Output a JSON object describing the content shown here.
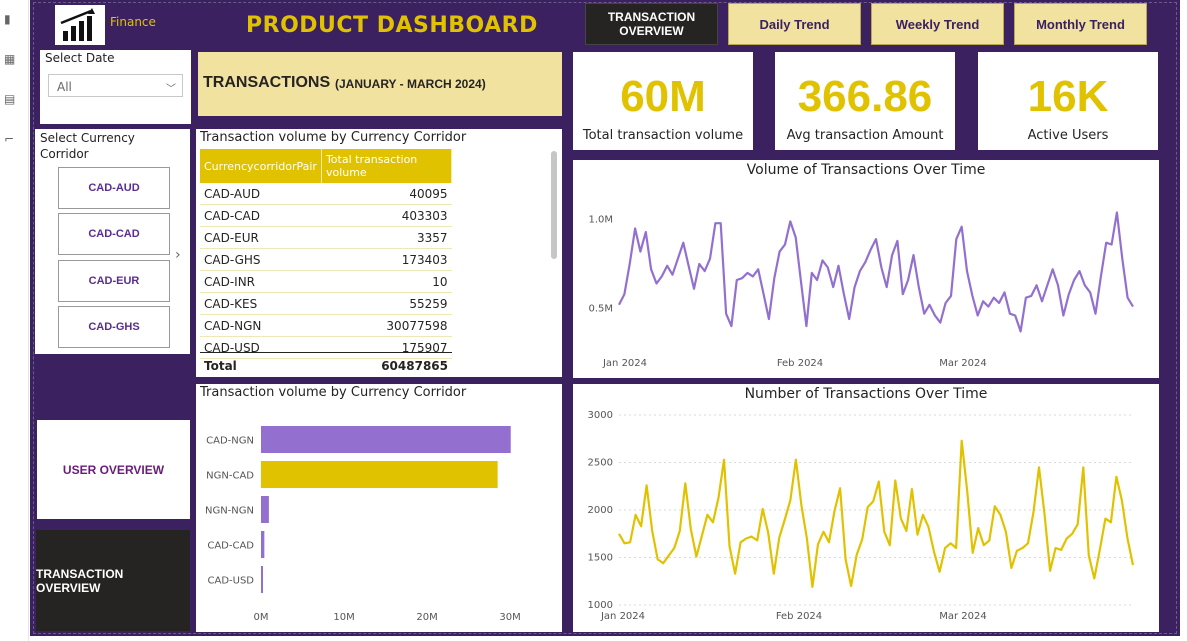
{
  "header": {
    "brand": "Finance",
    "title": "PRODUCT DASHBOARD"
  },
  "nav": {
    "transaction_overview": "TRANSACTION\nOVERVIEW",
    "daily_trend": "Daily Trend",
    "weekly_trend": "Weekly Trend",
    "monthly_trend": "Monthly Trend"
  },
  "date_filter": {
    "label": "Select Date",
    "value": "All"
  },
  "transactions_banner": {
    "title": "TRANSACTIONS",
    "range": "(JANUARY - MARCH 2024)"
  },
  "kpis": [
    {
      "value": "60M",
      "label": "Total transaction volume"
    },
    {
      "value": "366.86",
      "label": "Avg transaction Amount"
    },
    {
      "value": "16K",
      "label": "Active Users"
    }
  ],
  "currency_slicer": {
    "label": "Select Currency Corridor",
    "items": [
      "CAD-AUD",
      "CAD-CAD",
      "CAD-EUR",
      "CAD-GHS"
    ]
  },
  "volume_table": {
    "title": "Transaction volume by Currency Corridor",
    "columns": [
      "CurrencycorridorPair",
      "Total transaction volume"
    ],
    "rows": [
      [
        "CAD-AUD",
        "40095"
      ],
      [
        "CAD-CAD",
        "403303"
      ],
      [
        "CAD-EUR",
        "3357"
      ],
      [
        "CAD-GHS",
        "173403"
      ],
      [
        "CAD-INR",
        "10"
      ],
      [
        "CAD-KES",
        "55259"
      ],
      [
        "CAD-NGN",
        "30077598"
      ],
      [
        "CAD-USD",
        "175907"
      ]
    ],
    "total_label": "Total",
    "total_value": "60487865"
  },
  "side_buttons": {
    "user_overview": "USER OVERVIEW",
    "transaction_overview": "TRANSACTION OVERVIEW"
  },
  "colors": {
    "purple": "#9370d0",
    "gold": "#e1c200",
    "canvas": "#3b2160"
  },
  "chart_data": [
    {
      "type": "bar",
      "orientation": "horizontal",
      "title": "Transaction volume by Currency Corridor",
      "categories": [
        "CAD-NGN",
        "NGN-CAD",
        "NGN-NGN",
        "CAD-CAD",
        "CAD-USD"
      ],
      "values": [
        30077598,
        28500000,
        950000,
        403303,
        175907
      ],
      "bar_colors": [
        "#9370d0",
        "#e1c200",
        "#9370d0",
        "#9370d0",
        "#9370d0"
      ],
      "xticks": [
        "0M",
        "10M",
        "20M",
        "30M"
      ],
      "xlim": [
        0,
        33000000
      ]
    },
    {
      "type": "line",
      "title": "Volume of Transactions Over Time",
      "x_labels": [
        "Jan 2024",
        "Feb 2024",
        "Mar 2024"
      ],
      "yticks": [
        "0.5M",
        "1.0M"
      ],
      "ylim": [
        0.35,
        1.15
      ],
      "color": "#9370d0",
      "values": [
        0.52,
        0.58,
        0.75,
        0.95,
        0.82,
        0.93,
        0.72,
        0.64,
        0.68,
        0.74,
        0.69,
        0.78,
        0.87,
        0.74,
        0.61,
        0.75,
        0.71,
        0.78,
        0.98,
        0.98,
        0.47,
        0.4,
        0.66,
        0.67,
        0.7,
        0.68,
        0.72,
        0.58,
        0.44,
        0.67,
        0.82,
        0.86,
        0.99,
        0.9,
        0.65,
        0.4,
        0.7,
        0.66,
        0.77,
        0.73,
        0.62,
        0.74,
        0.58,
        0.44,
        0.62,
        0.71,
        0.76,
        0.83,
        0.89,
        0.73,
        0.62,
        0.8,
        0.88,
        0.58,
        0.66,
        0.8,
        0.62,
        0.47,
        0.52,
        0.46,
        0.42,
        0.53,
        0.57,
        0.89,
        0.96,
        0.71,
        0.57,
        0.46,
        0.54,
        0.51,
        0.56,
        0.53,
        0.59,
        0.47,
        0.46,
        0.37,
        0.56,
        0.57,
        0.63,
        0.54,
        0.63,
        0.72,
        0.63,
        0.46,
        0.58,
        0.66,
        0.71,
        0.63,
        0.59,
        0.47,
        0.68,
        0.87,
        0.86,
        1.04,
        0.78,
        0.56,
        0.51
      ]
    },
    {
      "type": "line",
      "title": "Number of Transactions Over Time",
      "x_labels": [
        "Jan 2024",
        "Feb 2024",
        "Mar 2024"
      ],
      "yticks": [
        "1000",
        "1500",
        "2000",
        "2500",
        "3000"
      ],
      "ylim": [
        1000,
        3000
      ],
      "color": "#e1c200",
      "values": [
        1750,
        1650,
        1660,
        1950,
        1830,
        2260,
        1780,
        1480,
        1440,
        1520,
        1600,
        1780,
        2280,
        1800,
        1510,
        1730,
        1950,
        1870,
        2130,
        2530,
        1620,
        1330,
        1660,
        1700,
        1720,
        1680,
        2010,
        1760,
        1330,
        1710,
        1900,
        2100,
        2530,
        2050,
        1700,
        1190,
        1640,
        1770,
        1660,
        1990,
        2230,
        1480,
        1200,
        1530,
        1690,
        2030,
        2090,
        2300,
        1770,
        1630,
        2310,
        1910,
        1780,
        2220,
        1740,
        1950,
        1820,
        1560,
        1350,
        1600,
        1650,
        1600,
        2730,
        2200,
        1550,
        1810,
        1630,
        1680,
        2040,
        1950,
        1770,
        1390,
        1570,
        1600,
        1650,
        1980,
        2450,
        1950,
        1360,
        1600,
        1580,
        1700,
        1750,
        1850,
        2450,
        1520,
        1280,
        1580,
        1910,
        1870,
        2350,
        2100,
        1700,
        1420
      ]
    }
  ]
}
